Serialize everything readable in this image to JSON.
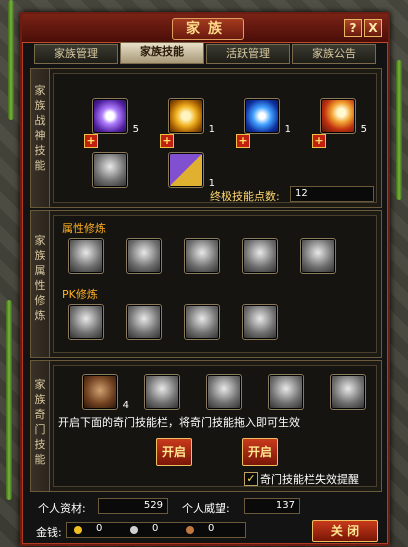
{
  "window": {
    "title": "家族",
    "help_button": "?",
    "close_x": "X"
  },
  "tabs": [
    {
      "label": "家族管理",
      "active": false
    },
    {
      "label": "家族技能",
      "active": true
    },
    {
      "label": "活跃管理",
      "active": false
    },
    {
      "label": "家族公告",
      "active": false
    }
  ],
  "sections": {
    "battle_skills": {
      "label": "家族战神技能",
      "skills": [
        {
          "icon": "purple-star-icon",
          "count": "5"
        },
        {
          "icon": "gold-orbs-icon",
          "count": "1"
        },
        {
          "icon": "lightning-icon",
          "count": "1"
        },
        {
          "icon": "potion-bottle-icon",
          "count": "5"
        }
      ],
      "row2": [
        {
          "icon": "armor-icon",
          "count": ""
        },
        {
          "icon": "combo-skill-icon",
          "count": "1"
        }
      ],
      "ultimate_label": "终极技能点数:",
      "ultimate_value": "12"
    },
    "attribute_training": {
      "label": "家族属性修炼",
      "attr_heading": "属性修炼",
      "pk_heading": "PK修炼"
    },
    "secret_skills": {
      "label": "家族奇门技能",
      "first_count": "4",
      "hint": "开启下面的奇门技能栏，将奇门技能拖入即可生效",
      "open_button_1": "开启",
      "open_button_2": "开启",
      "checkbox_label": "奇门技能栏失效提醒",
      "checkbox_checked": true,
      "checkbox_mark": "✓"
    }
  },
  "footer": {
    "personal_funds_label": "个人资材:",
    "personal_funds_value": "529",
    "personal_prestige_label": "个人威望:",
    "personal_prestige_value": "137",
    "money_label": "金钱:",
    "gold": "0",
    "silver": "0",
    "copper": "0",
    "close_button": "关 闭"
  },
  "colors": {
    "accent_red": "#7a1608",
    "heading_orange": "#ffb020",
    "border_gold": "#f0c060"
  }
}
